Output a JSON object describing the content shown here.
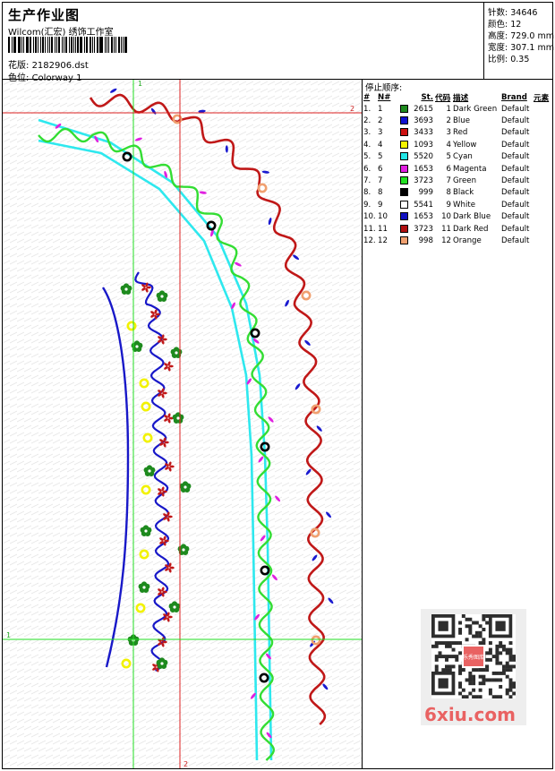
{
  "header": {
    "title": "生产作业图",
    "company": "Wilcom(汇宏) 绣饰工作室",
    "file_label": "花版:",
    "file_value": "2182906.dst",
    "colorway_label": "色位:",
    "colorway_value": "Colorway 1"
  },
  "meta": {
    "stitches_label": "针数:",
    "stitches_value": "34646",
    "colors_label": "颜色:",
    "colors_value": "12",
    "height_label": "高度:",
    "height_value": "729.0 mm",
    "width_label": "宽度:",
    "width_value": "307.1 mm",
    "scale_label": "比例:",
    "scale_value": "0.35"
  },
  "stop_list": {
    "title": "停止顺序:",
    "columns": [
      "#",
      "N#",
      "St.",
      "代码",
      "描述",
      "Brand",
      "元素"
    ],
    "rows": [
      {
        "n": "1.",
        "needle": "1",
        "color": "#1e8a1e",
        "st": "2615",
        "code": "1",
        "desc": "Dark Green",
        "brand": "Default"
      },
      {
        "n": "2.",
        "needle": "2",
        "color": "#1010d0",
        "st": "3693",
        "code": "2",
        "desc": "Blue",
        "brand": "Default"
      },
      {
        "n": "3.",
        "needle": "3",
        "color": "#cc1010",
        "st": "3433",
        "code": "3",
        "desc": "Red",
        "brand": "Default"
      },
      {
        "n": "4.",
        "needle": "4",
        "color": "#f4f400",
        "st": "1093",
        "code": "4",
        "desc": "Yellow",
        "brand": "Default"
      },
      {
        "n": "5.",
        "needle": "5",
        "color": "#22e6e6",
        "st": "5520",
        "code": "5",
        "desc": "Cyan",
        "brand": "Default"
      },
      {
        "n": "6.",
        "needle": "6",
        "color": "#e01ee0",
        "st": "1653",
        "code": "6",
        "desc": "Magenta",
        "brand": "Default"
      },
      {
        "n": "7.",
        "needle": "7",
        "color": "#22e022",
        "st": "3723",
        "code": "7",
        "desc": "Green",
        "brand": "Default"
      },
      {
        "n": "8.",
        "needle": "8",
        "color": "#000000",
        "st": "999",
        "code": "8",
        "desc": "Black",
        "brand": "Default"
      },
      {
        "n": "9.",
        "needle": "9",
        "color": "#ffffff",
        "st": "5541",
        "code": "9",
        "desc": "White",
        "brand": "Default"
      },
      {
        "n": "10.",
        "needle": "10",
        "color": "#1010c0",
        "st": "1653",
        "code": "10",
        "desc": "Dark Blue",
        "brand": "Default"
      },
      {
        "n": "11.",
        "needle": "11",
        "color": "#b01010",
        "st": "3723",
        "code": "11",
        "desc": "Dark Red",
        "brand": "Default"
      },
      {
        "n": "12.",
        "needle": "12",
        "color": "#f0a070",
        "st": "998",
        "code": "12",
        "desc": "Orange",
        "brand": "Default"
      }
    ]
  },
  "guides": {
    "h1_label": "1",
    "h2_label": "2",
    "v1_label": "1",
    "v2_label": "2"
  },
  "watermark": {
    "site": "6xiu.com",
    "seal_text": "乐秀图库"
  },
  "colors": {
    "guide_green": "#22dd22",
    "guide_red": "#dd2020",
    "thread_red": "#c01818",
    "thread_blue": "#1818c8",
    "thread_green": "#33dd33",
    "thread_cyan": "#2ee8ee",
    "leaf_blue": "#1a1ad0",
    "leaf_magenta": "#e020e0",
    "dot_orange": "#f0a070",
    "dot_yellow": "#f2f200",
    "flower_green": "#1e8a1e"
  }
}
